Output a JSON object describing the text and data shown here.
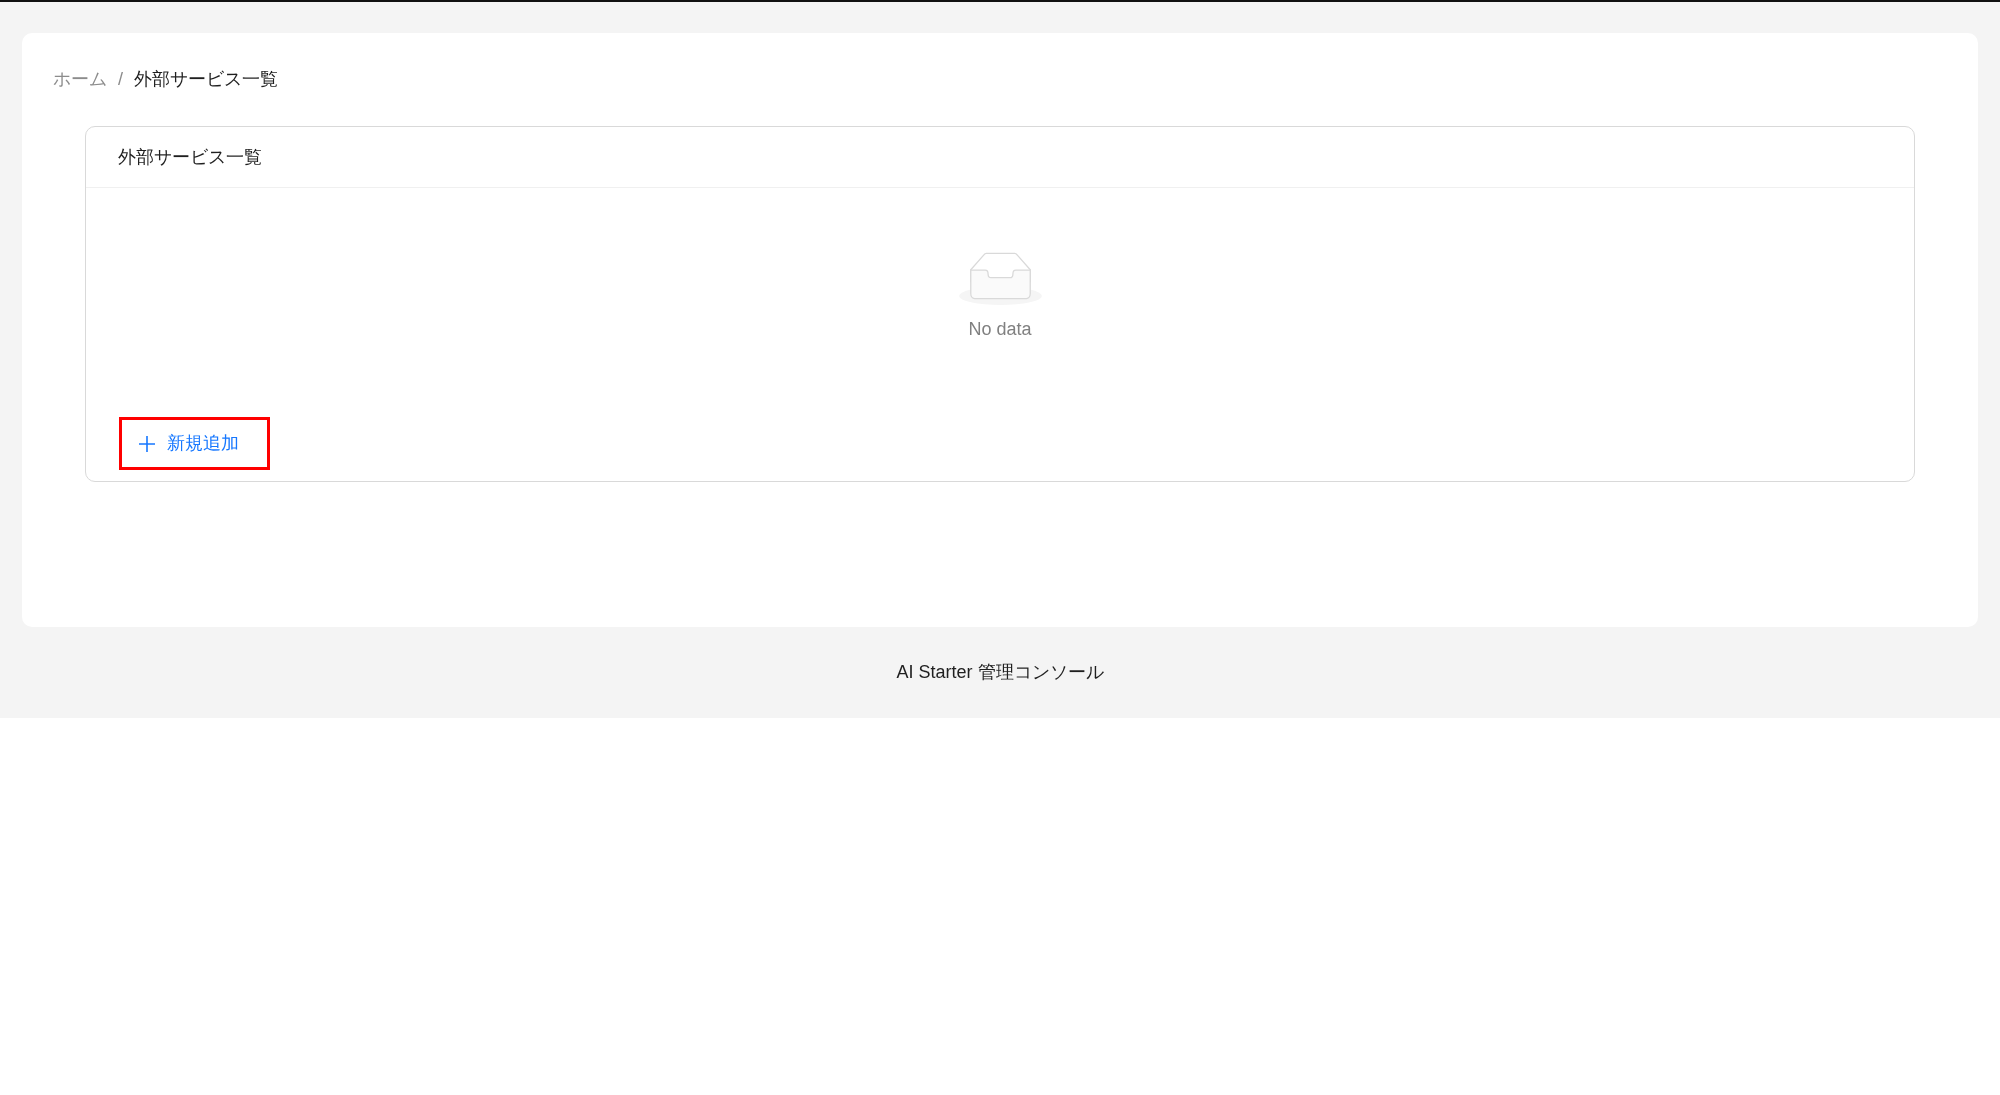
{
  "breadcrumb": {
    "separator": "/",
    "items": [
      {
        "label": "ホーム",
        "current": false
      },
      {
        "label": "外部サービス一覧",
        "current": true
      }
    ]
  },
  "card": {
    "title": "外部サービス一覧",
    "empty_text": "No data",
    "add_button": {
      "label": "新規追加",
      "highlighted": true
    }
  },
  "footer": "AI Starter 管理コンソール"
}
